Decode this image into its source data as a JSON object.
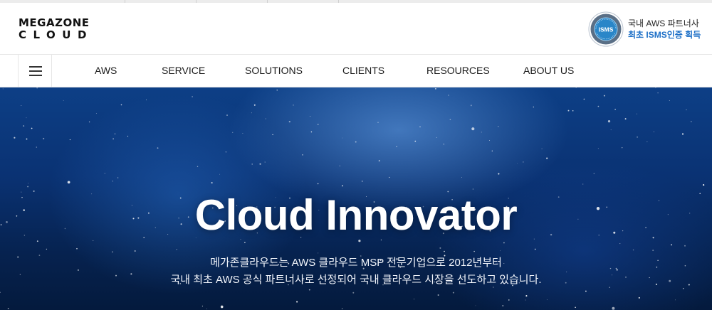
{
  "header": {
    "logo_line1": "MEGAZONE",
    "logo_line2": "CLOUD",
    "badge_text": "ISMS",
    "partner_line1": "국내 AWS 파트너사",
    "partner_line2": "최초 ISMS인증 획득"
  },
  "nav": {
    "items": [
      {
        "label": "AWS"
      },
      {
        "label": "SERVICE"
      },
      {
        "label": "SOLUTIONS"
      },
      {
        "label": "CLIENTS"
      },
      {
        "label": "RESOURCES"
      },
      {
        "label": "ABOUT US"
      }
    ]
  },
  "hero": {
    "title": "Cloud Innovator",
    "subtitle_line1": "메가존클라우드는 AWS 클라우드 MSP 전문기업으로 2012년부터",
    "subtitle_line2": "국내 최초 AWS 공식 파트너사로 선정되어 국내 클라우드 시장을 선도하고 있습니다."
  },
  "icons": {
    "menu": "hamburger-menu-icon",
    "badge": "isms-certification-badge"
  },
  "colors": {
    "accent_blue": "#1c6fc7",
    "hero_dark": "#06224f",
    "badge_blue": "#2a86c8"
  }
}
